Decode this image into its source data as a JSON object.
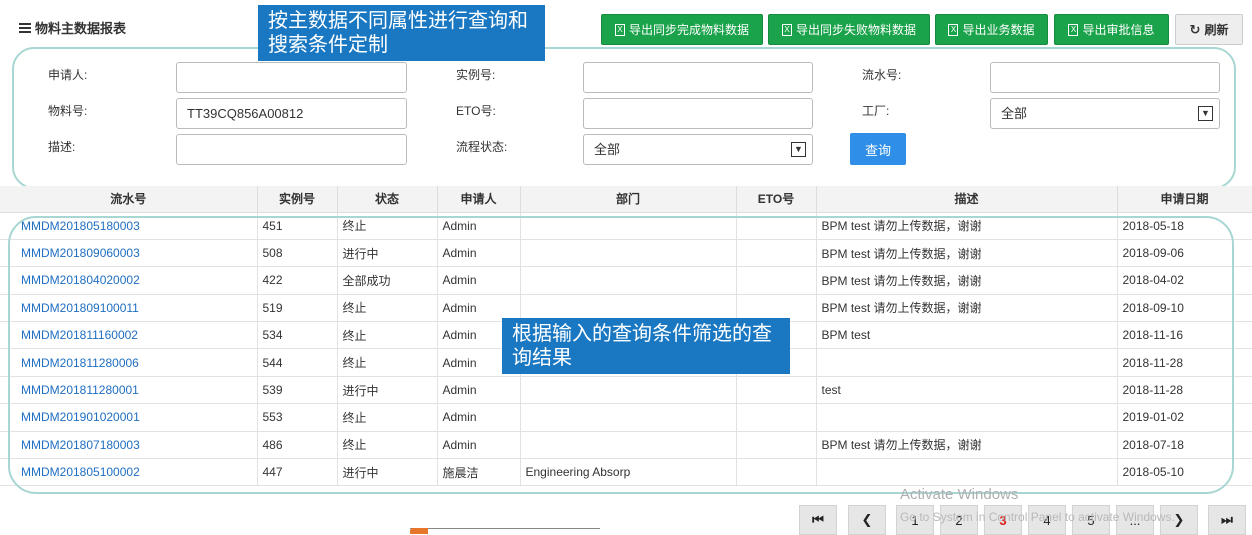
{
  "header": {
    "title": "物料主数据报表",
    "buttons": [
      {
        "label": "导出同步完成物料数据",
        "icon": "excel-icon"
      },
      {
        "label": "导出同步失败物料数据",
        "icon": "excel-icon"
      },
      {
        "label": "导出业务数据",
        "icon": "excel-icon"
      },
      {
        "label": "导出审批信息",
        "icon": "excel-icon"
      }
    ],
    "refresh_label": "刷新"
  },
  "callouts": {
    "top": "按主数据不同属性进行查询和搜索条件定制",
    "middle": "根据输入的查询条件筛选的查询结果"
  },
  "search": {
    "applicant_label": "申请人:",
    "applicant_value": "",
    "instance_label": "实例号:",
    "instance_value": "",
    "serial_label": "流水号:",
    "serial_value": "",
    "material_label": "物料号:",
    "material_value": "TT39CQ856A00812",
    "eto_label": "ETO号:",
    "eto_value": "",
    "factory_label": "工厂:",
    "factory_value": "全部",
    "desc_label": "描述:",
    "desc_value": "",
    "status_label": "流程状态:",
    "status_value": "全部",
    "query_label": "查询"
  },
  "table": {
    "headers": [
      "流水号",
      "实例号",
      "状态",
      "申请人",
      "部门",
      "ETO号",
      "描述",
      "申请日期"
    ],
    "rows": [
      [
        "MMDM201805180003",
        "451",
        "终止",
        "Admin",
        "",
        "",
        "BPM test 请勿上传数据，谢谢",
        "2018-05-18"
      ],
      [
        "MMDM201809060003",
        "508",
        "进行中",
        "Admin",
        "",
        "",
        "BPM test 请勿上传数据，谢谢",
        "2018-09-06"
      ],
      [
        "MMDM201804020002",
        "422",
        "全部成功",
        "Admin",
        "",
        "",
        "BPM test 请勿上传数据，谢谢",
        "2018-04-02"
      ],
      [
        "MMDM201809100011",
        "519",
        "终止",
        "Admin",
        "",
        "",
        "BPM test 请勿上传数据，谢谢",
        "2018-09-10"
      ],
      [
        "MMDM201811160002",
        "534",
        "终止",
        "Admin",
        "",
        "",
        "BPM test",
        "2018-11-16"
      ],
      [
        "MMDM201811280006",
        "544",
        "终止",
        "Admin",
        "",
        "",
        "",
        "2018-11-28"
      ],
      [
        "MMDM201811280001",
        "539",
        "进行中",
        "Admin",
        "",
        "",
        "test",
        "2018-11-28"
      ],
      [
        "MMDM201901020001",
        "553",
        "终止",
        "Admin",
        "",
        "",
        "",
        "2019-01-02"
      ],
      [
        "MMDM201807180003",
        "486",
        "终止",
        "Admin",
        "",
        "",
        "BPM test 请勿上传数据，谢谢",
        "2018-07-18"
      ],
      [
        "MMDM201805100002",
        "447",
        "进行中",
        "施晨洁",
        "Engineering Absorp",
        "",
        "",
        "2018-05-10"
      ]
    ]
  },
  "watermark": {
    "line1": "Activate Windows",
    "line2": "Go to System in Control Panel to activate Windows."
  },
  "pager": {
    "first": "⏮",
    "prev": "❮",
    "pages": [
      "1",
      "2",
      "3",
      "4",
      "5",
      "..."
    ],
    "current": "3",
    "next": "❯",
    "last": "⏭"
  }
}
